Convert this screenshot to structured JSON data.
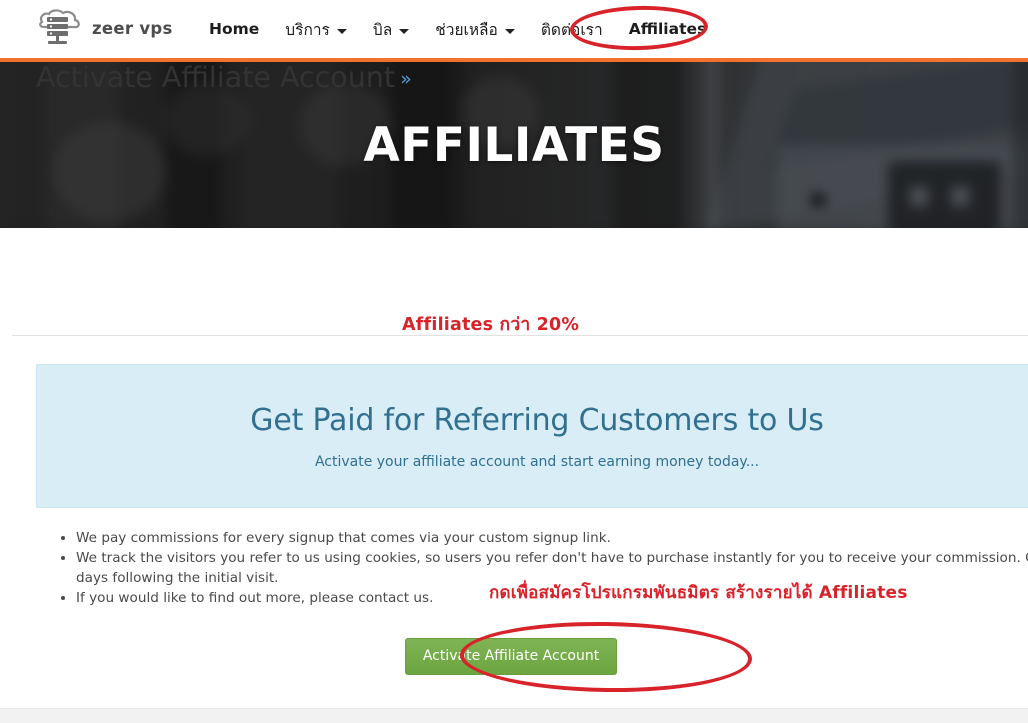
{
  "brand": {
    "name": "zeer vps",
    "logo_icon": "cloud-server-icon"
  },
  "nav": {
    "items": [
      {
        "label": "Home",
        "has_caret": false,
        "active": false,
        "thai": false
      },
      {
        "label": "บริการ",
        "has_caret": true,
        "active": false,
        "thai": true
      },
      {
        "label": "บิล",
        "has_caret": true,
        "active": false,
        "thai": true
      },
      {
        "label": "ช่วยเหลือ",
        "has_caret": true,
        "active": false,
        "thai": true
      },
      {
        "label": "ติดต่อเรา",
        "has_caret": false,
        "active": false,
        "thai": true
      },
      {
        "label": "Affiliates",
        "has_caret": false,
        "active": true,
        "thai": false
      }
    ]
  },
  "hero": {
    "title": "AFFILIATES",
    "accent_color": "#f2712c",
    "background": "dark-blurred-server-rack"
  },
  "main": {
    "heading": "Activate Affiliate Account",
    "heading_chevron": "»",
    "panel": {
      "title": "Get Paid for Referring Customers to Us",
      "subtitle": "Activate your affiliate account and start earning money today...",
      "background_color": "#d9edf7",
      "text_color": "#31708f"
    },
    "bullets": [
      "We pay commissions for every signup that comes via your custom signup link.",
      "We track the visitors you refer to us using cookies, so users you refer don't have to purchase instantly for you to receive your commission. Coo",
      "days following the initial visit.",
      "If you would like to find out more, please contact us."
    ],
    "activate_button": {
      "label": "Activate Affiliate Account",
      "color": "#74ad48"
    }
  },
  "annotations": {
    "color": "#d8232a",
    "percent_note": "Affiliates กว่า   20%",
    "thai_note": "กดเพื่อสมัครโปรแกรมพันธมิตร   สร้างรายได้   Affiliates",
    "ellipse_nav_target": "Affiliates",
    "ellipse_button_target": "Activate Affiliate Account"
  }
}
